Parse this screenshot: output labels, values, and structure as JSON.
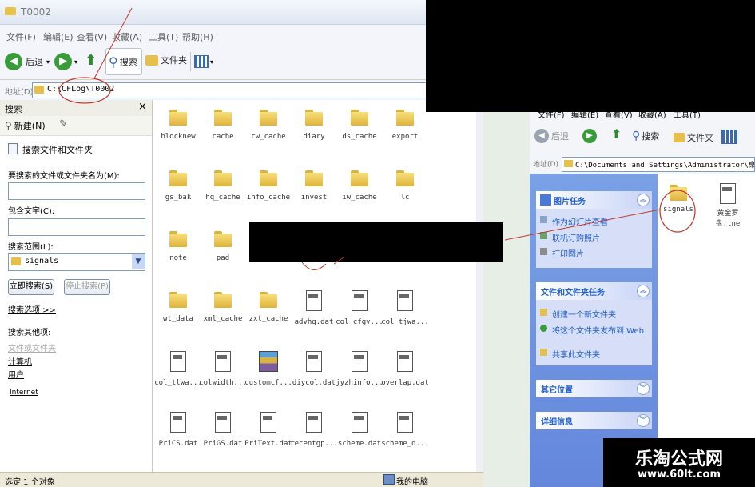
{
  "left_window": {
    "title": "T0002",
    "menu": [
      "文件(F)",
      "编辑(E)",
      "查看(V)",
      "收藏(A)",
      "工具(T)",
      "帮助(H)"
    ],
    "toolbar": {
      "back": "后退",
      "search": "搜索",
      "folders": "文件夹"
    },
    "address": {
      "label": "地址(D)",
      "value": "C:\\CFLog\\T0002"
    },
    "search_pane": {
      "title": "搜索",
      "close": "×",
      "new_button": "新建(N)",
      "heading": "搜索文件和文件夹",
      "name_label": "要搜索的文件或文件夹名为(M):",
      "contains_label": "包含文字(C):",
      "scope_label": "搜索范围(L):",
      "scope_value": "signals",
      "search_now": "立即搜索(S)",
      "stop_search": "停止搜索(P)",
      "options": "搜索选项 >>",
      "other_label": "搜索其他项:",
      "other_items": [
        "文件或文件夹",
        "计算机",
        "用户"
      ],
      "internet": "Internet"
    },
    "files": [
      {
        "name": "blocknew",
        "type": "folder"
      },
      {
        "name": "cache",
        "type": "folder"
      },
      {
        "name": "cw_cache",
        "type": "folder"
      },
      {
        "name": "diary",
        "type": "folder"
      },
      {
        "name": "ds_cache",
        "type": "folder"
      },
      {
        "name": "export",
        "type": "folder"
      },
      {
        "name": "gs_bak",
        "type": "folder"
      },
      {
        "name": "hq_cache",
        "type": "folder"
      },
      {
        "name": "info_cache",
        "type": "folder"
      },
      {
        "name": "invest",
        "type": "folder"
      },
      {
        "name": "iw_cache",
        "type": "folder"
      },
      {
        "name": "lc",
        "type": "folder"
      },
      {
        "name": "note",
        "type": "folder"
      },
      {
        "name": "pad",
        "type": "folder"
      },
      {
        "name": "",
        "type": "hidden"
      },
      {
        "name": "",
        "type": "hidden"
      },
      {
        "name": "",
        "type": "hidden"
      },
      {
        "name": "",
        "type": "hidden"
      },
      {
        "name": "wt_data",
        "type": "folder"
      },
      {
        "name": "xml_cache",
        "type": "folder"
      },
      {
        "name": "zxt_cache",
        "type": "folder"
      },
      {
        "name": "advhq.dat",
        "type": "file"
      },
      {
        "name": "col_cfgv...",
        "type": "file"
      },
      {
        "name": "col_tjwa...",
        "type": "file"
      },
      {
        "name": "col_tlwa...",
        "type": "file"
      },
      {
        "name": "colwidth...",
        "type": "file"
      },
      {
        "name": "customcf...",
        "type": "rar"
      },
      {
        "name": "diycol.dat",
        "type": "file"
      },
      {
        "name": "jyzhinfo...",
        "type": "file"
      },
      {
        "name": "overlap.dat",
        "type": "file"
      },
      {
        "name": "PriCS.dat",
        "type": "file"
      },
      {
        "name": "PriGS.dat",
        "type": "file"
      },
      {
        "name": "PriText.dat",
        "type": "file"
      },
      {
        "name": "recentgp...",
        "type": "file"
      },
      {
        "name": "scheme.dat",
        "type": "file"
      },
      {
        "name": "scheme_d...",
        "type": "file"
      }
    ],
    "status": {
      "left": "选定 1 个对象",
      "right": "我的电脑"
    }
  },
  "right_window": {
    "menu": [
      "文件(F)",
      "编辑(E)",
      "查看(V)",
      "收藏(A)",
      "工具(T)"
    ],
    "toolbar": {
      "back": "后退",
      "search": "搜索",
      "folders": "文件夹"
    },
    "address": {
      "label": "地址(D)",
      "value": "C:\\Documents and Settings\\Administrator\\桌面\\黄金罗"
    },
    "panels": [
      {
        "title": "图片任务",
        "links": [
          "作为幻灯片查看",
          "联机订购照片",
          "打印图片"
        ]
      },
      {
        "title": "文件和文件夹任务",
        "links": [
          "创建一个新文件夹",
          "将这个文件夹发布到 Web",
          "共享此文件夹"
        ]
      },
      {
        "title": "其它位置",
        "links": []
      },
      {
        "title": "详细信息",
        "links": []
      }
    ],
    "files": [
      {
        "name": "signals",
        "type": "folder"
      },
      {
        "name": "黄金罗盘.tne",
        "type": "file"
      }
    ]
  },
  "watermark": {
    "line1": "乐淘公式网",
    "line2": "www.60lt.com"
  },
  "colors": {
    "annotation": "#c0392b",
    "panel_link": "#215dc6"
  }
}
